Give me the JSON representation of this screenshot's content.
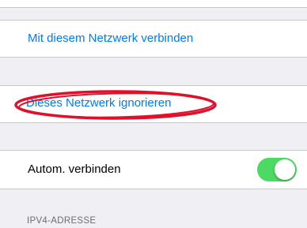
{
  "network": {
    "connect_label": "Mit diesem Netzwerk verbinden",
    "ignore_label": "Dieses Netzwerk ignorieren",
    "auto_join_label": "Autom. verbinden",
    "auto_join_on": true,
    "ipv4_header": "IPV4-ADRESSE"
  },
  "colors": {
    "link": "#007aff",
    "toggle_on": "#4cd964",
    "annotation": "#e0102a",
    "background": "#efeff4"
  },
  "annotation": {
    "shape": "ellipse",
    "target": "ignore-network-item"
  }
}
